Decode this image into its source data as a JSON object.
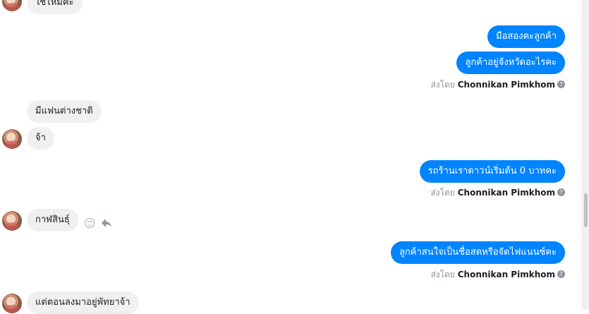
{
  "messages": {
    "incoming_1": "ใช่ไหมคะ",
    "outgoing_1": "มือสองคะลูกค้า",
    "outgoing_2": "ลูกค้าอยู่จังหวัดอะไรคะ",
    "incoming_2": "มีแฟนต่างชาติ",
    "incoming_3": "จ้า",
    "outgoing_3": "รถร้านเราดาวน์เริ่มต้น 0 บาทคะ",
    "incoming_4": "กาฬสินธุ์",
    "outgoing_4": "ลูกค้าสนใจเป็นชื่อสดหรือจัดไฟแนนซ์คะ",
    "incoming_5": "แต่ตอนลงมาอยู่พัทยาจ้า"
  },
  "sent_by": {
    "prefix": "ส่งโดย",
    "name": "Chonnikan Pimkhom",
    "help_glyph": "?"
  },
  "colors": {
    "outgoing_bubble": "#0084ff",
    "incoming_bubble": "#f1f0f0"
  },
  "icons": [
    "emoji-icon",
    "reply-icon",
    "help-icon"
  ]
}
